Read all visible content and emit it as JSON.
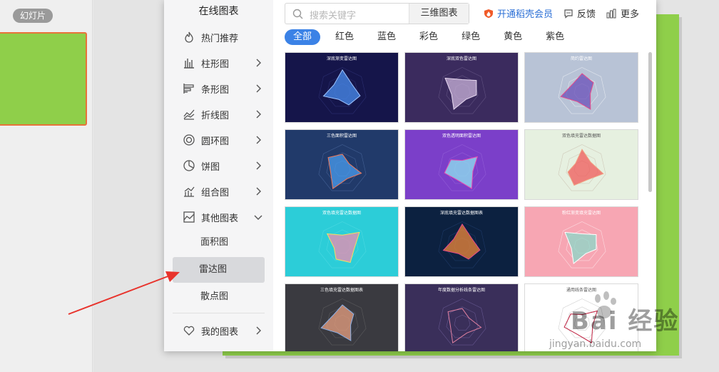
{
  "left_panel": {
    "tab_label": "幻灯片"
  },
  "dialog": {
    "sidebar": {
      "title": "在线图表",
      "items": [
        {
          "label": "热门推荐",
          "icon": "flame-icon"
        },
        {
          "label": "柱形图",
          "icon": "column-chart-icon"
        },
        {
          "label": "条形图",
          "icon": "bar-chart-icon"
        },
        {
          "label": "折线图",
          "icon": "line-chart-icon"
        },
        {
          "label": "圆环图",
          "icon": "donut-chart-icon"
        },
        {
          "label": "饼图",
          "icon": "pie-chart-icon"
        },
        {
          "label": "组合图",
          "icon": "combo-chart-icon"
        },
        {
          "label": "其他图表",
          "icon": "area-chart-icon"
        }
      ],
      "sub_items": [
        "面积图",
        "雷达图",
        "散点图"
      ],
      "active_sub": "雷达图",
      "my_charts": "我的图表"
    },
    "search": {
      "placeholder": "搜索关键字",
      "scope": "三维图表"
    },
    "top_links": {
      "vip": "开通稻壳会员",
      "feedback": "反馈",
      "more": "更多"
    },
    "filters": [
      "全部",
      "红色",
      "蓝色",
      "彩色",
      "绿色",
      "黄色",
      "紫色"
    ],
    "active_filter": "全部",
    "cards": [
      {
        "title": "深底渐变雷达图",
        "bg": "#15154a"
      },
      {
        "title": "深底双色雷达图",
        "bg": "#3b2b5e"
      },
      {
        "title": "简约雷达图",
        "bg": "#b8c3d6"
      },
      {
        "title": "三色面积雷达图",
        "bg": "#213a6a"
      },
      {
        "title": "双色透明面积雷达图",
        "bg": "#7b3fc9"
      },
      {
        "title": "双色填充雷达数据图",
        "bg": "#e6f0e0"
      },
      {
        "title": "双色填充雷达数据图",
        "bg": "#2ccdd8"
      },
      {
        "title": "深底填充雷达数据图表",
        "bg": "#0c2140"
      },
      {
        "title": "粉红渐变填充雷达图",
        "bg": "#f7a6b3"
      },
      {
        "title": "三色填充雷达数据图表",
        "bg": "#3a3a40"
      },
      {
        "title": "年度数据分析线条雷达图",
        "bg": "#3a2f5a"
      },
      {
        "title": "通用线条雷达图",
        "bg": "#ffffff"
      }
    ]
  },
  "watermark": {
    "brand": "Bai 经验",
    "url": "jingyan.baidu.com"
  }
}
